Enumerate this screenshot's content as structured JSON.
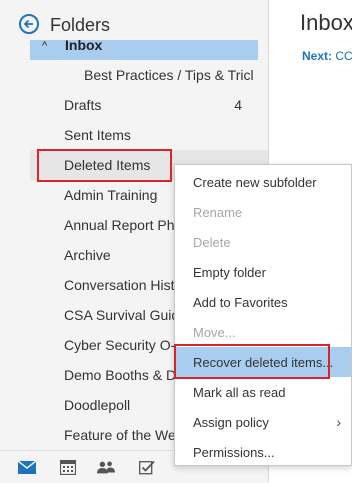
{
  "pane": {
    "title": "Folders",
    "inbox_label": "Inbox",
    "folders": [
      {
        "label": "Best Practices / Tips & Tricl",
        "count": ""
      },
      {
        "label": "Drafts",
        "count": "4"
      },
      {
        "label": "Sent Items",
        "count": ""
      },
      {
        "label": "Deleted Items",
        "count": ""
      },
      {
        "label": "Admin Training",
        "count": ""
      },
      {
        "label": "Annual Report Pho",
        "count": ""
      },
      {
        "label": "Archive",
        "count": ""
      },
      {
        "label": "Conversation Histo",
        "count": ""
      },
      {
        "label": "CSA Survival Guide",
        "count": ""
      },
      {
        "label": "Cyber Security O-N",
        "count": ""
      },
      {
        "label": "Demo Booths & Do",
        "count": ""
      },
      {
        "label": "Doodlepoll",
        "count": ""
      },
      {
        "label": "Feature of the We",
        "count": ""
      }
    ]
  },
  "bottom_nav": [
    "mail-icon",
    "calendar-icon",
    "people-icon",
    "tasks-icon"
  ],
  "reading": {
    "title": "Inbox",
    "next_key": "Next:",
    "next_value": "CC"
  },
  "context_menu": {
    "items": [
      {
        "label": "Create new subfolder",
        "enabled": true
      },
      {
        "label": "Rename",
        "enabled": false
      },
      {
        "label": "Delete",
        "enabled": false
      },
      {
        "label": "Empty folder",
        "enabled": true
      },
      {
        "label": "Add to Favorites",
        "enabled": true
      },
      {
        "label": "Move...",
        "enabled": false
      },
      {
        "label": "Recover deleted items...",
        "enabled": true,
        "highlighted": true
      },
      {
        "label": "Mark all as read",
        "enabled": true
      },
      {
        "label": "Assign policy",
        "enabled": true,
        "submenu": true
      },
      {
        "label": "Permissions...",
        "enabled": true
      }
    ],
    "submenu_arrow": "›"
  },
  "colors": {
    "accent": "#1e73be",
    "selection": "#a9cdee",
    "annotation": "#d9252a",
    "pane_bg": "#f4f4f4"
  }
}
